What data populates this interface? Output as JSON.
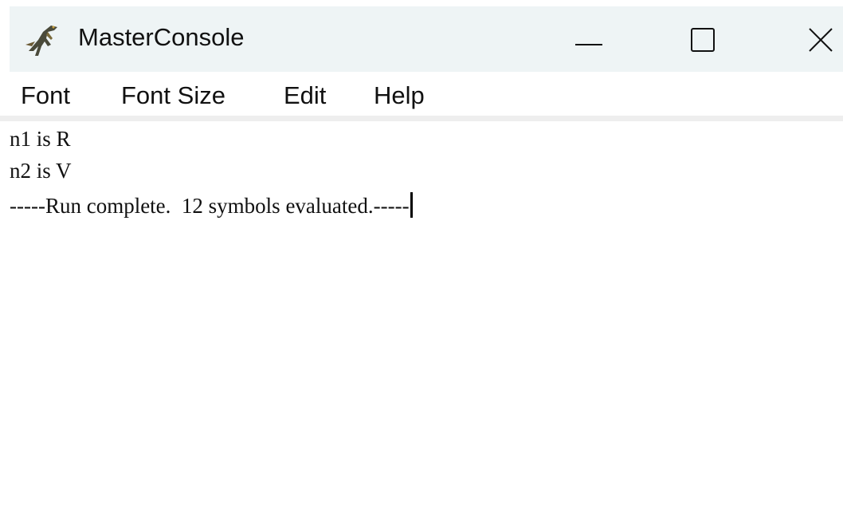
{
  "window": {
    "title": "MasterConsole",
    "icon": "dinosaur-app-icon",
    "controls": {
      "minimize_icon": "minimize-icon",
      "maximize_icon": "maximize-icon",
      "close_icon": "close-icon"
    }
  },
  "menu": {
    "items": [
      {
        "label": "Font"
      },
      {
        "label": "Font Size"
      },
      {
        "label": "Edit"
      },
      {
        "label": "Help"
      }
    ]
  },
  "console": {
    "lines": [
      "n1 is R",
      "n2 is V",
      "-----Run complete.  12 symbols evaluated.-----"
    ]
  },
  "colors": {
    "titlebar_bg": "#eef4f5",
    "text": "#111111",
    "background": "#ffffff"
  }
}
